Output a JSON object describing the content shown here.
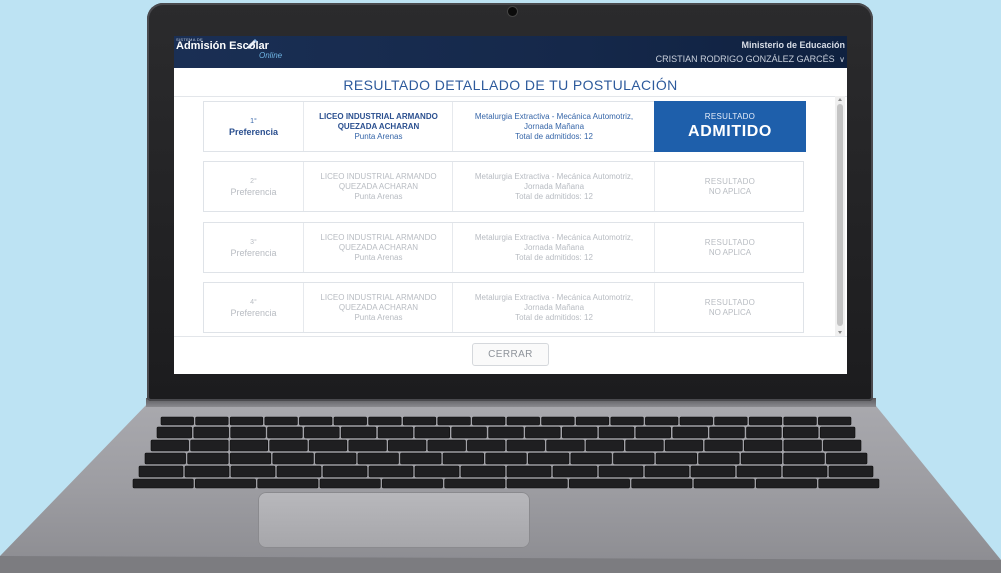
{
  "header": {
    "brand_small": "SISTEMA DE",
    "brand": "Admisión Escolar",
    "brand_online": "Online",
    "ministry": "Ministerio de Educación",
    "user": "CRISTIAN RODRIGO GONZÁLEZ GARCÉS"
  },
  "page": {
    "title": "RESULTADO DETALLADO DE TU POSTULACIÓN"
  },
  "preferences": [
    {
      "number": "1°",
      "label": "Preferencia",
      "school_line1": "LICEO INDUSTRIAL ARMANDO",
      "school_line2": "QUEZADA ACHARAN",
      "city": "Punta Arenas",
      "career_line1": "Metalurgia Extractiva - Mecánica Automotriz,",
      "career_line2": "Jornada Mañana",
      "career_line3": "Total de admitidos: 12",
      "result_label": "RESULTADO",
      "result_value": "ADMITIDO"
    },
    {
      "number": "2°",
      "label": "Preferencia",
      "school_line1": "LICEO INDUSTRIAL ARMANDO",
      "school_line2": "QUEZADA ACHARAN",
      "city": "Punta Arenas",
      "career_line1": "Metalurgia Extractiva - Mecánica Automotriz,",
      "career_line2": "Jornada Mañana",
      "career_line3": "Total de admitidos: 12",
      "result_label": "RESULTADO",
      "result_value": "NO APLICA"
    },
    {
      "number": "3°",
      "label": "Preferencia",
      "school_line1": "LICEO INDUSTRIAL ARMANDO",
      "school_line2": "QUEZADA ACHARAN",
      "city": "Punta Arenas",
      "career_line1": "Metalurgia Extractiva - Mecánica Automotriz,",
      "career_line2": "Jornada Mañana",
      "career_line3": "Total de admitidos: 12",
      "result_label": "RESULTADO",
      "result_value": "NO APLICA"
    },
    {
      "number": "4°",
      "label": "Preferencia",
      "school_line1": "LICEO INDUSTRIAL ARMANDO",
      "school_line2": "QUEZADA ACHARAN",
      "city": "Punta Arenas",
      "career_line1": "Metalurgia Extractiva - Mecánica Automotriz,",
      "career_line2": "Jornada Mañana",
      "career_line3": "Total de admitidos: 12",
      "result_label": "RESULTADO",
      "result_value": "NO APLICA"
    }
  ],
  "footer": {
    "close_label": "CERRAR"
  },
  "colors": {
    "background": "#bde3f3",
    "header_bg": "#15284a",
    "accent": "#1e5fab",
    "title": "#2d5a9c",
    "muted": "#b8bcc2"
  },
  "icons": {
    "user_menu": "chevron-down-icon",
    "brand_mark": "pencil-icon"
  }
}
